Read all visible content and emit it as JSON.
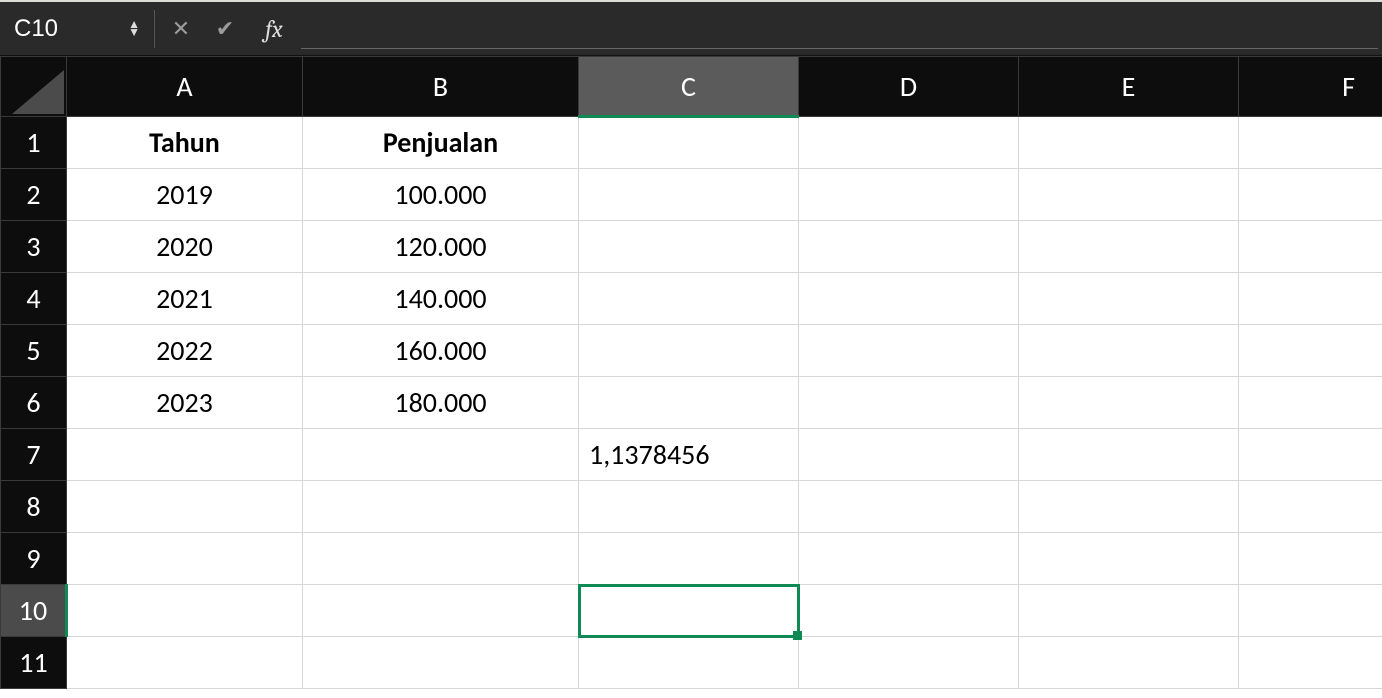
{
  "formula_bar": {
    "cell_ref": "C10",
    "formula_value": "",
    "fx_label": "fx"
  },
  "grid": {
    "columns": [
      "A",
      "B",
      "C",
      "D",
      "E",
      "F"
    ],
    "row_count": 11,
    "active_cell": {
      "col": "C",
      "row": 10
    },
    "cells": {
      "A1": "Tahun",
      "B1": "Penjualan",
      "A2": "2019",
      "B2": "100.000",
      "A3": "2020",
      "B3": "120.000",
      "A4": "2021",
      "B4": "140.000",
      "A5": "2022",
      "B5": "160.000",
      "A6": "2023",
      "B6": "180.000",
      "C7": "1,1378456"
    }
  }
}
